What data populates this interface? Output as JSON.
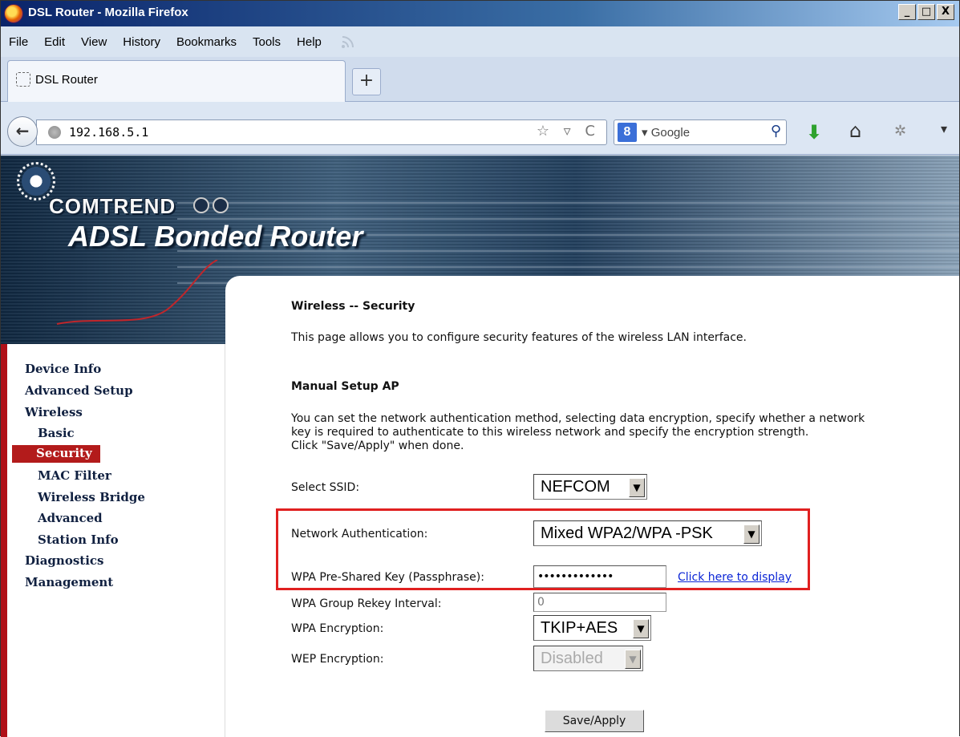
{
  "window": {
    "title": "DSL Router - Mozilla Firefox",
    "controls": {
      "minimize": "_",
      "maximize": "□",
      "close": "X"
    }
  },
  "menubar": [
    "File",
    "Edit",
    "View",
    "History",
    "Bookmarks",
    "Tools",
    "Help"
  ],
  "tabs": [
    {
      "label": "DSL Router"
    }
  ],
  "new_tab": "+",
  "navbar": {
    "url": "192.168.5.1",
    "url_icons": "☆ ▿ C",
    "search_engine": "Google",
    "search_engine_badge": "8",
    "search_dropdown": "▾"
  },
  "icons": {
    "back": "back-arrow-icon",
    "globe": "globe-icon",
    "search": "magnifier-icon",
    "download": "download-arrow-icon",
    "home": "home-icon",
    "addon": "addon-icon",
    "menu": "menu-arrow-icon",
    "rss": "rss-icon"
  },
  "banner": {
    "brand": "COMTREND",
    "title": "ADSL Bonded Router"
  },
  "sidebar": {
    "items": [
      {
        "label": "Device Info"
      },
      {
        "label": "Advanced Setup"
      },
      {
        "label": "Wireless"
      },
      {
        "label": "Basic"
      },
      {
        "label": "Security",
        "active": true
      },
      {
        "label": "MAC Filter"
      },
      {
        "label": "Wireless Bridge"
      },
      {
        "label": "Advanced"
      },
      {
        "label": "Station Info"
      },
      {
        "label": "Diagnostics"
      },
      {
        "label": "Management"
      }
    ]
  },
  "main": {
    "page_title": "Wireless -- Security",
    "page_desc": "This page allows you to configure security features of the wireless LAN interface.",
    "section_title": "Manual Setup AP",
    "section_desc_1": "You can set the network authentication method, selecting data encryption, specify whether a network",
    "section_desc_2": "key is required to authenticate to this wireless network and specify the encryption strength.",
    "section_desc_3": "Click \"Save/Apply\" when done.",
    "fields": {
      "ssid": {
        "label": "Select SSID:",
        "value": "NEFCOM"
      },
      "auth": {
        "label": "Network Authentication:",
        "value": "Mixed WPA2/WPA -PSK"
      },
      "psk": {
        "label": "WPA Pre-Shared Key (Passphrase):",
        "value": "•••••••••••••",
        "link": "Click here to display"
      },
      "rekey": {
        "label": "WPA Group Rekey Interval:",
        "value": "0"
      },
      "wpa_enc": {
        "label": "WPA Encryption:",
        "value": "TKIP+AES"
      },
      "wep_enc": {
        "label": "WEP Encryption:",
        "value": "Disabled"
      }
    },
    "save_button": "Save/Apply"
  },
  "colors": {
    "highlight": "#e02020",
    "sidebar_active": "#b31b1b",
    "link": "#0b25d6"
  }
}
